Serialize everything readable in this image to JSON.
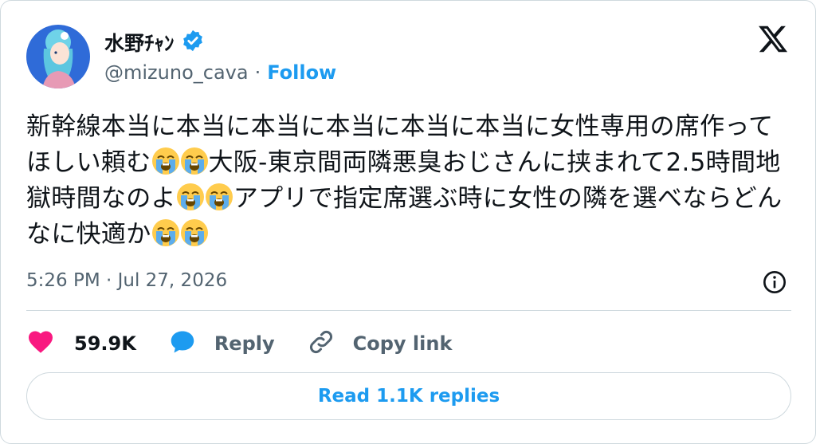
{
  "author": {
    "display_name": "水野ﾁｬﾝ",
    "handle": "@mizuno_cava",
    "separator": "·",
    "follow_label": "Follow"
  },
  "tweet": {
    "segments": [
      {
        "type": "text",
        "value": "新幹線本当に本当に本当に本当に本当に本当に女性専用の席作ってほしい頼む"
      },
      {
        "type": "emoji",
        "name": "loudly-crying-face-emoji"
      },
      {
        "type": "emoji",
        "name": "loudly-crying-face-emoji"
      },
      {
        "type": "text",
        "value": "大阪-東京間両隣悪臭おじさんに挟まれて2.5時間地獄時間なのよ"
      },
      {
        "type": "emoji",
        "name": "loudly-crying-face-emoji"
      },
      {
        "type": "emoji",
        "name": "loudly-crying-face-emoji"
      },
      {
        "type": "text",
        "value": "アプリで指定席選ぶ時に女性の隣を選べならどんなに快適か"
      },
      {
        "type": "emoji",
        "name": "loudly-crying-face-emoji"
      },
      {
        "type": "emoji",
        "name": "loudly-crying-face-emoji"
      }
    ],
    "timestamp": "5:26 PM · Jul 27, 2026"
  },
  "actions": {
    "like_count": "59.9K",
    "reply_label": "Reply",
    "copy_link_label": "Copy link"
  },
  "replies_button_label": "Read 1.1K replies",
  "colors": {
    "accent": "#1d9bf0",
    "like": "#f91880",
    "muted": "#536471",
    "border": "#cfd9de"
  }
}
